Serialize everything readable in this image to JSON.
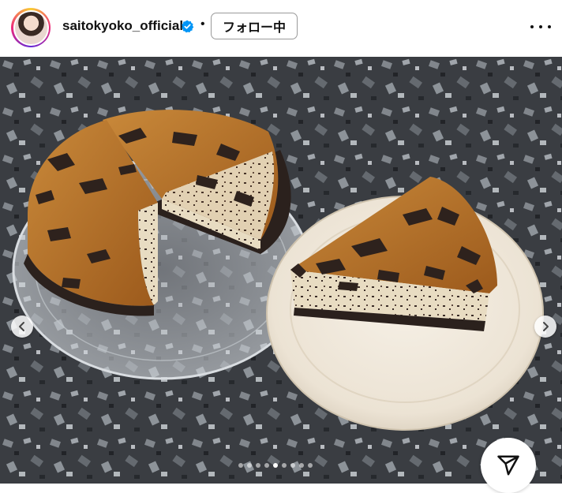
{
  "header": {
    "username": "saitokyoko_official",
    "separator": "•",
    "follow_label": "フォロー中"
  },
  "icons": {
    "verified": "verified-badge-icon",
    "more": "more-options-icon",
    "prev": "chevron-left-icon",
    "next": "chevron-right-icon",
    "share": "send-icon"
  },
  "colors": {
    "verified_blue": "#0095f6",
    "text": "#111111"
  },
  "carousel": {
    "total": 9,
    "active_index": 4
  }
}
